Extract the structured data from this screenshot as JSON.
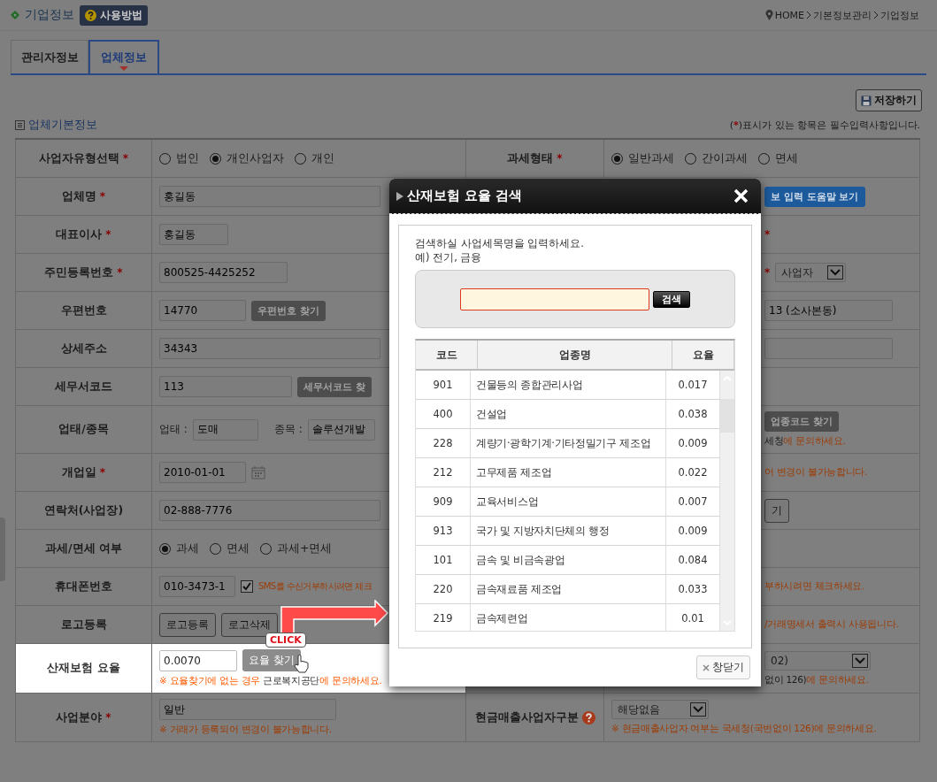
{
  "header": {
    "title": "기업정보",
    "help_button": "사용방법",
    "breadcrumb": [
      "HOME",
      "기본정보관리",
      "기업정보"
    ]
  },
  "tabs": [
    {
      "label": "관리자정보",
      "selected": false
    },
    {
      "label": "업체정보",
      "selected": true
    }
  ],
  "save_button": "저장하기",
  "section": {
    "title": "업체기본정보",
    "note_open": "(",
    "note_mark": "*",
    "note_text": ")표시가 있는 항목은 필수입력사항입니다."
  },
  "form_rows": [
    {
      "label": "사업자유형선택",
      "mark": "*",
      "highlighted": false,
      "value": [
        {
          "kind": "radio",
          "label": "법인",
          "selected": false
        },
        {
          "kind": "radio",
          "label": "개인사업자",
          "selected": true
        },
        {
          "kind": "radio",
          "label": "개인",
          "selected": false
        }
      ],
      "right_label": "과세형태",
      "right_mark": "*",
      "right_help": false,
      "right_value": [
        {
          "kind": "radio",
          "label": "일반과세",
          "selected": true
        },
        {
          "kind": "radio",
          "label": "간이과세",
          "selected": false
        },
        {
          "kind": "radio",
          "label": "면세",
          "selected": false
        }
      ]
    },
    {
      "label": "업체명",
      "mark": "*",
      "highlighted": false,
      "value": [
        {
          "kind": "input",
          "value": "홍길동"
        }
      ],
      "right_value": [
        {
          "kind": "button",
          "label": "보 입력 도움말 보기"
        }
      ]
    },
    {
      "label": "대표이사",
      "mark": "*",
      "highlighted": false,
      "value": [
        {
          "kind": "input",
          "value": "홍길동"
        }
      ],
      "right_value": [
        {
          "kind": "star",
          "text": "*"
        }
      ]
    },
    {
      "label": "주민등록번호",
      "mark": "*",
      "highlighted": false,
      "value": [
        {
          "kind": "input",
          "value": "800525-4425252"
        }
      ],
      "right_value": [
        {
          "kind": "star",
          "text": "*"
        },
        {
          "kind": "select",
          "value": "사업자"
        }
      ]
    },
    {
      "label": "우편번호",
      "highlighted": false,
      "value": [
        {
          "kind": "input",
          "value": "14770"
        },
        {
          "kind": "button",
          "label": "우편번호 찾기"
        }
      ],
      "right_value": [
        {
          "kind": "input",
          "value": "13 (소사본동)"
        }
      ]
    },
    {
      "label": "상세주소",
      "highlighted": false,
      "value": [
        {
          "kind": "input",
          "value": "34343"
        }
      ],
      "right_value": [
        {
          "kind": "input"
        }
      ]
    },
    {
      "label": "세무서코드",
      "highlighted": false,
      "value": [
        {
          "kind": "input",
          "value": "113"
        },
        {
          "kind": "button",
          "label": "세무서코드 찾"
        }
      ]
    },
    {
      "label": "업태/종목",
      "highlighted": false,
      "value": [
        {
          "kind": "labeled_input",
          "caption": "업태 :",
          "value": "도매"
        },
        {
          "kind": "labeled_input",
          "caption": "종목 :",
          "value": "솔루션개발"
        }
      ],
      "right_value": [
        {
          "kind": "button",
          "label": "업종코드 찾기"
        },
        {
          "kind": "note",
          "text": "**세청**에 문의하세요."
        }
      ]
    },
    {
      "label": "개업일",
      "mark": "*",
      "highlighted": false,
      "value": [
        {
          "kind": "date",
          "value": "2010-01-01"
        }
      ],
      "right_value": [
        {
          "kind": "note",
          "text": "어 변경이 불가능합니다."
        }
      ]
    },
    {
      "label": "연락처(사업장)",
      "highlighted": false,
      "value": [
        {
          "kind": "input",
          "value": "02-888-7776"
        }
      ],
      "right_value": [
        {
          "kind": "button",
          "label": "기"
        }
      ]
    },
    {
      "label": "과세/면세 여부",
      "highlighted": false,
      "value": [
        {
          "kind": "radio",
          "label": "과세",
          "selected": true
        },
        {
          "kind": "radio",
          "label": "면세",
          "selected": false
        },
        {
          "kind": "radio",
          "label": "과세+면세",
          "selected": false
        }
      ]
    },
    {
      "label": "휴대폰번호",
      "highlighted": false,
      "value": [
        {
          "kind": "input",
          "value": "010-3473-1"
        },
        {
          "kind": "checkbox",
          "checked": true,
          "label": "SMS를 수신거부하시려면 체크"
        }
      ],
      "right_value": [
        {
          "kind": "note",
          "text": "부하시려면 체크하세요."
        }
      ]
    },
    {
      "label": "로고등록",
      "highlighted": false,
      "value": [
        {
          "kind": "button",
          "label": "로고등록"
        },
        {
          "kind": "button",
          "label": "로고삭제"
        }
      ],
      "right_value": [
        {
          "kind": "note",
          "text": "/거래명세서 출력시 사용됩니다."
        }
      ]
    },
    {
      "label": "산재보험 요율",
      "highlighted": true,
      "value": [
        {
          "kind": "input",
          "value": "0.0070"
        },
        {
          "kind": "button",
          "label": "요율 찾기"
        },
        {
          "kind": "note",
          "text": "※ 요율찾기에 없는 경우 **근로복지공단**에 문의하세요."
        }
      ],
      "right_value": [
        {
          "kind": "select",
          "value": "02)"
        },
        {
          "kind": "note",
          "text": "**없이 126)**에 문의하세요."
        }
      ]
    },
    {
      "label": "사업분야",
      "mark": "*",
      "highlighted": false,
      "value": [
        {
          "kind": "input",
          "value": "일반"
        },
        {
          "kind": "note",
          "text": "※ 거래가 등록되어 변경이 불가능합니다."
        }
      ],
      "right_label": "현금매출사업자구분",
      "right_help": true,
      "right_value": [
        {
          "kind": "select",
          "value": "해당없음"
        },
        {
          "kind": "note",
          "text": "※ 현금매출사업자 여부는 국세청(국번없이 126)에 문의하세요."
        }
      ]
    }
  ],
  "annotation": {
    "callout": "CLICK"
  },
  "dialog": {
    "title": "산재보험 요율 검색",
    "instruction": "검색하실 사업세목명을 입력하세요.",
    "example": "예) 전기, 금융",
    "search_button": "검색",
    "columns": [
      "코드",
      "업종명",
      "요율"
    ],
    "rows": [
      {
        "code": "901",
        "name": "건물등의 종합관리사업",
        "rate": "0.017"
      },
      {
        "code": "400",
        "name": "건설업",
        "rate": "0.038"
      },
      {
        "code": "228",
        "name": "계량기·광학기계·기타정밀기구 제조업",
        "rate": "0.009"
      },
      {
        "code": "212",
        "name": "고무제품 제조업",
        "rate": "0.022"
      },
      {
        "code": "909",
        "name": "교육서비스업",
        "rate": "0.007"
      },
      {
        "code": "913",
        "name": "국가 및 지방자치단체의 행정",
        "rate": "0.009"
      },
      {
        "code": "101",
        "name": "금속 및 비금속광업",
        "rate": "0.084"
      },
      {
        "code": "220",
        "name": "금속재료품 제조업",
        "rate": "0.033"
      },
      {
        "code": "219",
        "name": "금속제련업",
        "rate": "0.01"
      }
    ],
    "close_button": "창닫기"
  }
}
